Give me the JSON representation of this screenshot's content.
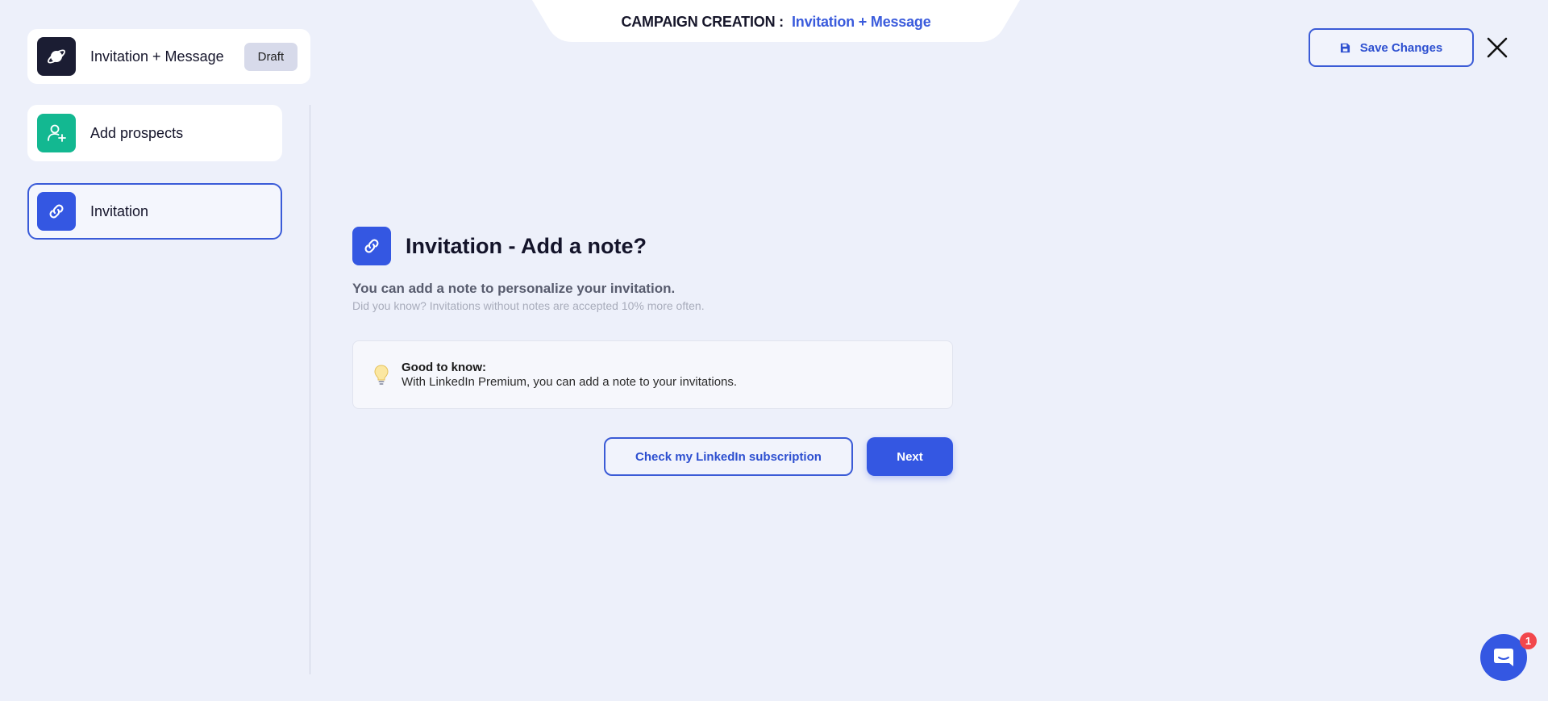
{
  "header": {
    "title_label": "CAMPAIGN CREATION :",
    "title_value": "Invitation + Message",
    "save_label": "Save Changes"
  },
  "sidebar": {
    "campaign": {
      "name": "Invitation + Message",
      "status": "Draft",
      "icon": "planet-icon"
    },
    "steps": [
      {
        "label": "Add prospects",
        "icon": "add-user-icon",
        "color": "#13b891"
      },
      {
        "label": "Invitation",
        "icon": "link-icon",
        "color": "#3457e2",
        "active": true
      }
    ]
  },
  "main": {
    "title": "Invitation - Add a note?",
    "subtitle": "You can add a note to personalize your invitation.",
    "hint": "Did you know? Invitations without notes are accepted 10% more often.",
    "info": {
      "title": "Good to know:",
      "text": "With LinkedIn Premium, you can add a note to your invitations."
    },
    "check_subscription_label": "Check my LinkedIn subscription",
    "next_label": "Next"
  },
  "chat": {
    "badge_count": "1"
  },
  "colors": {
    "accent": "#3457e2",
    "background": "#edf0fa",
    "green": "#13b891",
    "badge_red": "#f2474c"
  }
}
